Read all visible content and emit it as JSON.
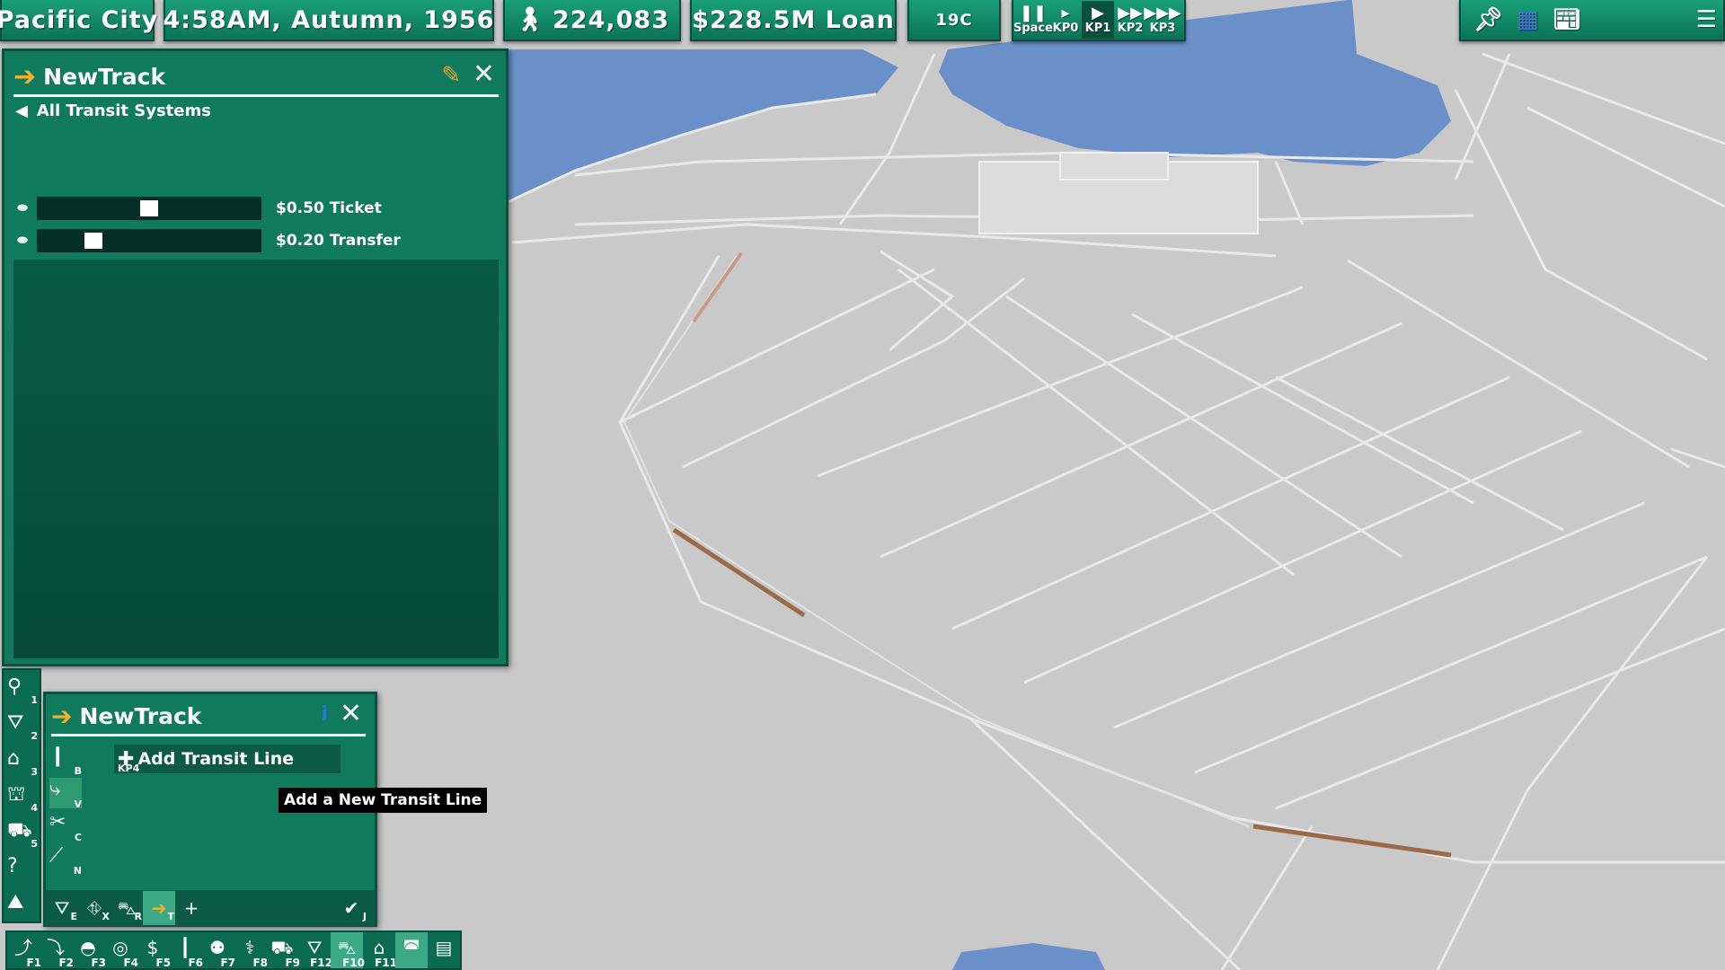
{
  "topbar": {
    "city": "Pacific City",
    "datetime": "4:58AM,  Autumn,  1956",
    "population": "224,083",
    "money": "$228.5M Loan",
    "temperature": "19C",
    "speed_buttons": [
      {
        "icon": "pause-icon",
        "glyph": "❚❚",
        "label": "Space"
      },
      {
        "icon": "slow-play-icon",
        "glyph": "▸",
        "label": "KP0"
      },
      {
        "icon": "play-icon",
        "glyph": "▶",
        "label": "KP1",
        "active": true
      },
      {
        "icon": "fast-forward-icon",
        "glyph": "▶▶",
        "label": "KP2"
      },
      {
        "icon": "fastest-forward-icon",
        "glyph": "▶▶▶",
        "label": "KP3"
      }
    ]
  },
  "panel": {
    "title": "NewTrack",
    "back_label": "All  Transit  Systems",
    "ticket_price": "$0.50  Ticket",
    "ticket_level": 0.5,
    "transfer_price": "$0.20  Transfer",
    "transfer_level": 0.23
  },
  "tools": [
    {
      "name": "query-tool",
      "icon": "magnifier-icon",
      "glyph": "⚲",
      "key": "1"
    },
    {
      "name": "roads-tool",
      "icon": "road-icon",
      "glyph": "⛛",
      "key": "2"
    },
    {
      "name": "zones-tool",
      "icon": "house-icon",
      "glyph": "⌂",
      "key": "3"
    },
    {
      "name": "buildings-tool",
      "icon": "government-icon",
      "glyph": "⛫",
      "key": "4"
    },
    {
      "name": "bulldozer-tool",
      "icon": "bulldozer-icon",
      "glyph": "⛟",
      "key": "5"
    },
    {
      "name": "help-tool",
      "icon": "help-icon",
      "glyph": "?",
      "key": ""
    },
    {
      "name": "terrain-tool",
      "icon": "terrain-icon",
      "glyph": "⛰",
      "key": ""
    }
  ],
  "panel2": {
    "title": "NewTrack",
    "add_line_key": "KP4",
    "add_line_label": "Add  Transit  Line",
    "tooltip": "Add  a  New  Transit  Line",
    "modes": [
      {
        "name": "mode-stop",
        "icon": "stop-pole-icon",
        "glyph": "❙",
        "key": "B"
      },
      {
        "name": "mode-line",
        "icon": "line-path-icon",
        "glyph": "⤷",
        "key": "V",
        "selected": true
      },
      {
        "name": "mode-cut",
        "icon": "scissors-icon",
        "glyph": "✂",
        "key": "C"
      },
      {
        "name": "mode-erase",
        "icon": "erase-line-icon",
        "glyph": "⟋",
        "key": "N"
      }
    ],
    "bottom_tools": [
      {
        "name": "road-transit-button",
        "icon": "road-icon",
        "glyph": "⛛",
        "key": "E"
      },
      {
        "name": "expressway-button",
        "icon": "expressway-icon",
        "glyph": "⛗",
        "key": "X"
      },
      {
        "name": "rail-button",
        "icon": "train-icon",
        "glyph": "⛍",
        "key": "R"
      },
      {
        "name": "transit-button",
        "icon": "transit-arrow-icon",
        "glyph": "➔",
        "key": "T",
        "selected": true
      },
      {
        "name": "add-button",
        "icon": "plus-icon",
        "glyph": "+",
        "key": ""
      }
    ],
    "confirm_key": "J"
  },
  "bottombar": [
    {
      "icon": "road-icon",
      "glyph": "⤴",
      "key": "F1"
    },
    {
      "icon": "zoning-icon",
      "glyph": "⤵",
      "key": "F2"
    },
    {
      "icon": "budget-icon",
      "glyph": "◓",
      "key": "F3"
    },
    {
      "icon": "globe-icon",
      "glyph": "◎",
      "key": "F4"
    },
    {
      "icon": "finance-icon",
      "glyph": "$",
      "key": "F5"
    },
    {
      "icon": "tower-icon",
      "glyph": "┃",
      "key": "F6"
    },
    {
      "icon": "people-icon",
      "glyph": "⚉",
      "key": "F7"
    },
    {
      "icon": "health-icon",
      "glyph": "⚕",
      "key": "F8"
    },
    {
      "icon": "vehicle-icon",
      "glyph": "⛟",
      "key": "F9"
    },
    {
      "icon": "traffic-icon",
      "glyph": "⛛",
      "key": "F12"
    },
    {
      "icon": "transit-icon",
      "glyph": "⛍",
      "key": "F10",
      "selected": true
    },
    {
      "icon": "housing-icon",
      "glyph": "⌂",
      "key": "F11"
    },
    {
      "icon": "car-icon",
      "glyph": "◚",
      "key": "",
      "selected": true
    },
    {
      "icon": "newspaper-icon",
      "glyph": "▤",
      "key": ""
    }
  ],
  "colors": {
    "panel": "#0f7a5c",
    "panel_dark": "#064a39",
    "water": "#6a8fc9",
    "ground": "#c9c9c9",
    "rail": "#9b6a4a",
    "accent": "#f3b12b"
  }
}
